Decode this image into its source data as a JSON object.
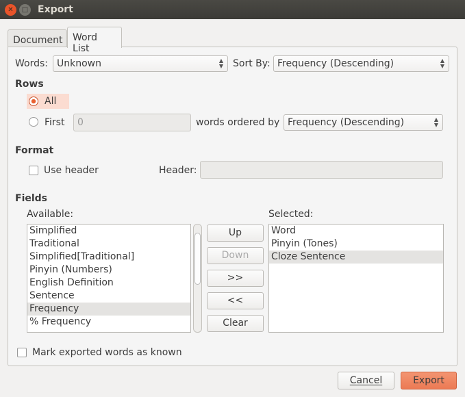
{
  "window": {
    "title": "Export"
  },
  "tabs": [
    {
      "label": "Document"
    },
    {
      "label": "Word List"
    }
  ],
  "words": {
    "label": "Words:",
    "value": "Unknown"
  },
  "sort_by": {
    "label": "Sort By:",
    "value": "Frequency (Descending)"
  },
  "rows": {
    "title": "Rows",
    "all_label": "All",
    "first_label": "First",
    "first_value": "0",
    "ordered_label": "words ordered by",
    "ordered_value": "Frequency (Descending)",
    "selected": "All"
  },
  "format": {
    "title": "Format",
    "use_header_label": "Use header",
    "use_header_checked": false,
    "header_label": "Header:",
    "header_value": ""
  },
  "fields": {
    "title": "Fields",
    "available_label": "Available:",
    "selected_label": "Selected:",
    "available": [
      "Simplified",
      "Traditional",
      "Simplified[Traditional]",
      "Pinyin (Numbers)",
      "English Definition",
      "Sentence",
      "Frequency",
      "% Frequency"
    ],
    "available_selected": "Frequency",
    "selected": [
      "Word",
      "Pinyin (Tones)",
      "Cloze Sentence"
    ],
    "selected_selected": "Cloze Sentence",
    "buttons": {
      "up": "Up",
      "down": "Down",
      "add": ">>",
      "remove": "<<",
      "clear": "Clear"
    }
  },
  "mark_known": {
    "label": "Mark exported words as known",
    "checked": false
  },
  "footer": {
    "cancel": "Cancel",
    "export": "Export"
  },
  "colors": {
    "accent": "#e9602f",
    "export_button": "#ef8560"
  }
}
